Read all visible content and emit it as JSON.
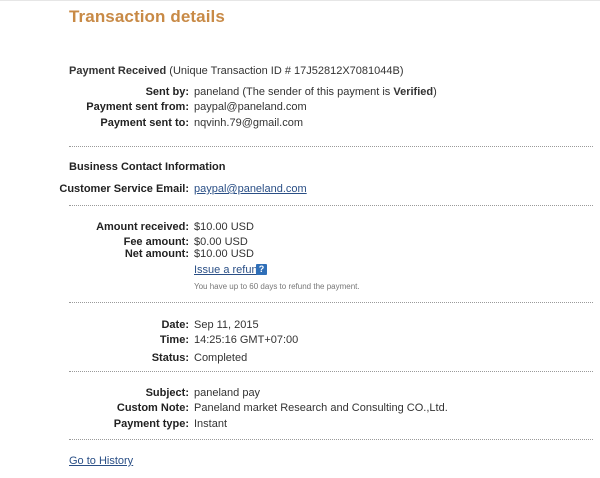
{
  "title": "Transaction details",
  "payment_received": {
    "label": "Payment Received",
    "txn_id": "(Unique Transaction ID # 17J52812X7081044B)",
    "sent_by_label": "Sent by:",
    "sent_by_value": "paneland (The sender of this payment is ",
    "sent_by_verified": "Verified",
    "sent_by_close": ")",
    "sent_from_label": "Payment sent from:",
    "sent_from_value": "paypal@paneland.com",
    "sent_to_label": "Payment sent to:",
    "sent_to_value": "nqvinh.79@gmail.com"
  },
  "business": {
    "heading": "Business Contact Information",
    "email_label": "Customer Service Email:",
    "email_value": "paypal@paneland.com"
  },
  "amounts": {
    "received_label": "Amount received:",
    "received_value": "$10.00 USD",
    "fee_label": "Fee amount:",
    "fee_value": "$0.00 USD",
    "net_label": "Net amount:",
    "net_value": "$10.00 USD",
    "refund_link": "Issue a refund",
    "help_icon": "?",
    "refund_note": "You have up to 60 days to refund the payment."
  },
  "status": {
    "date_label": "Date:",
    "date_value": "Sep 11, 2015",
    "time_label": "Time:",
    "time_value": "14:25:16 GMT+07:00",
    "status_label": "Status:",
    "status_value": "Completed"
  },
  "details": {
    "subject_label": "Subject:",
    "subject_value": "paneland pay",
    "note_label": "Custom Note:",
    "note_value": "Paneland market Research and Consulting CO.,Ltd.",
    "type_label": "Payment type:",
    "type_value": "Instant"
  },
  "footer": {
    "history_link": "Go to History"
  }
}
